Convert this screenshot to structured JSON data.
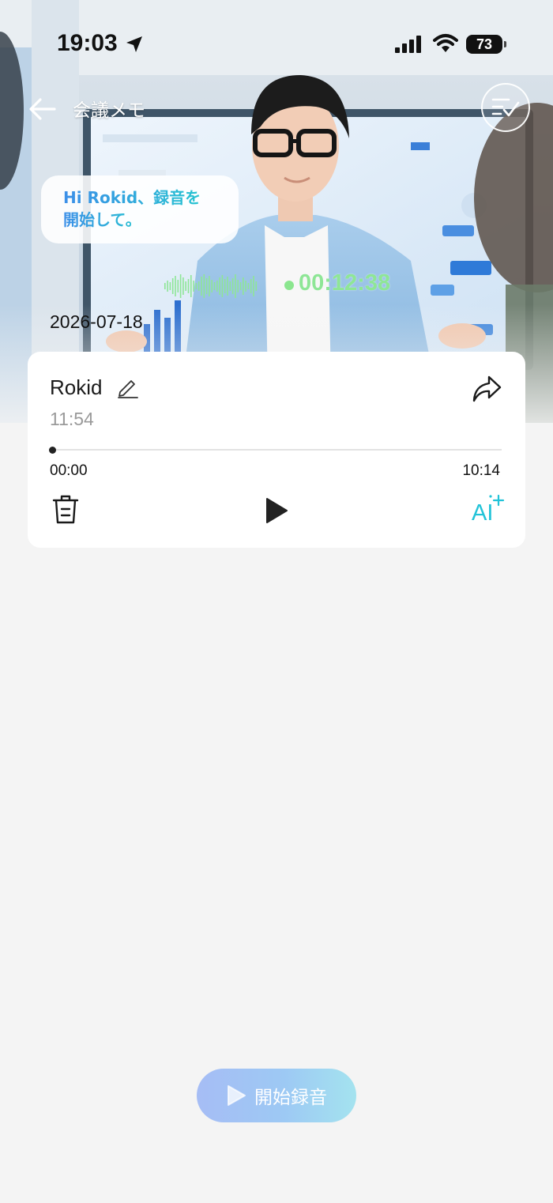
{
  "status_bar": {
    "time": "19:03",
    "battery": "73"
  },
  "nav": {
    "title": "会議メモ"
  },
  "hero": {
    "bubble_line1": "Hi Rokid、録音を",
    "bubble_line2": "開始して。",
    "timer": "00:12:38",
    "date": "2026-07-18"
  },
  "recording": {
    "title": "Rokid",
    "created_time": "11:54",
    "current_time": "00:00",
    "duration": "10:14",
    "progress": 0,
    "ai_label": "AI"
  },
  "start_button": {
    "label": "開始録音"
  },
  "colors": {
    "accent_cyan": "#22c3d8",
    "timer_green": "#8ee696",
    "background": "#f4f4f4"
  }
}
